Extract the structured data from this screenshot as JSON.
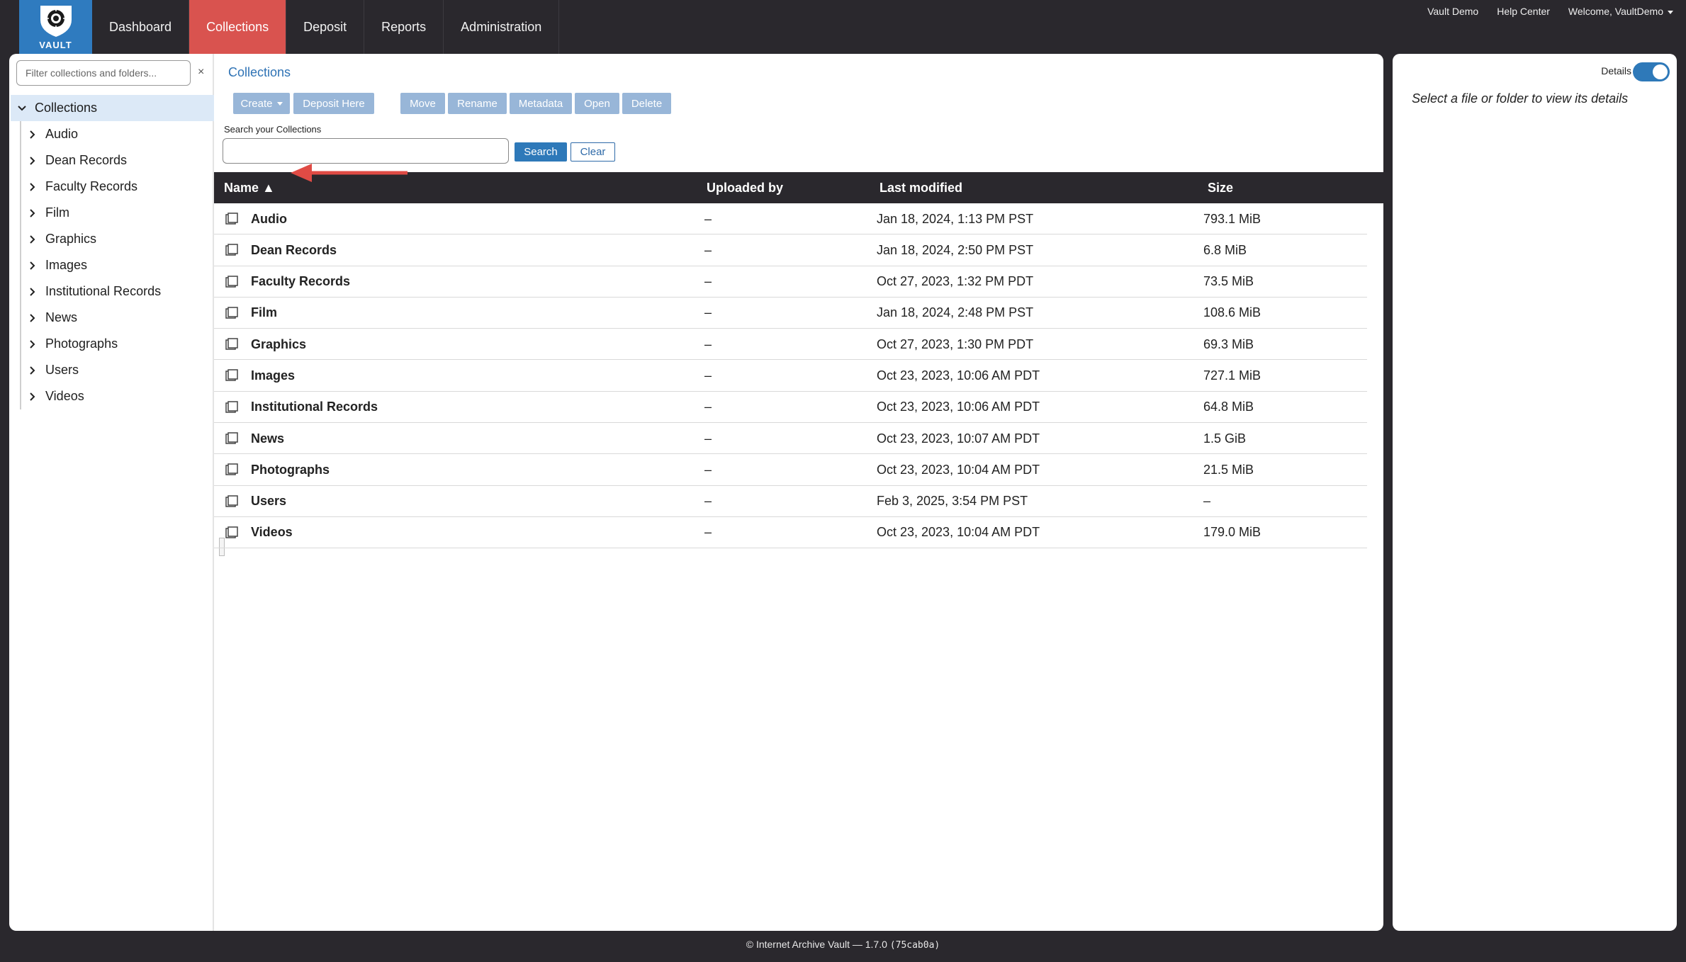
{
  "brand": {
    "logo_text": "VAULT"
  },
  "nav": {
    "items": [
      {
        "label": "Dashboard"
      },
      {
        "label": "Collections",
        "active": true
      },
      {
        "label": "Deposit"
      },
      {
        "label": "Reports"
      },
      {
        "label": "Administration"
      }
    ]
  },
  "toplinks": {
    "org": "Vault Demo",
    "help": "Help Center",
    "welcome": "Welcome, VaultDemo"
  },
  "sidebar": {
    "filter_placeholder": "Filter collections and folders...",
    "clear": "×",
    "root": "Collections",
    "items": [
      "Audio",
      "Dean Records",
      "Faculty Records",
      "Film",
      "Graphics",
      "Images",
      "Institutional Records",
      "News",
      "Photographs",
      "Users",
      "Videos"
    ]
  },
  "content": {
    "breadcrumb": "Collections",
    "toolbar": {
      "create": "Create",
      "deposit_here": "Deposit Here",
      "move": "Move",
      "rename": "Rename",
      "metadata": "Metadata",
      "open": "Open",
      "delete": "Delete"
    },
    "search": {
      "label": "Search your Collections",
      "value": "",
      "search_btn": "Search",
      "clear_btn": "Clear"
    },
    "table": {
      "headers": {
        "name": "Name ▲",
        "uploaded_by": "Uploaded by",
        "last_modified": "Last modified",
        "size": "Size"
      },
      "rows": [
        {
          "name": "Audio",
          "uploaded_by": "–",
          "modified": "Jan 18, 2024, 1:13 PM PST",
          "size": "793.1 MiB"
        },
        {
          "name": "Dean Records",
          "uploaded_by": "–",
          "modified": "Jan 18, 2024, 2:50 PM PST",
          "size": "6.8 MiB"
        },
        {
          "name": "Faculty Records",
          "uploaded_by": "–",
          "modified": "Oct 27, 2023, 1:32 PM PDT",
          "size": "73.5 MiB"
        },
        {
          "name": "Film",
          "uploaded_by": "–",
          "modified": "Jan 18, 2024, 2:48 PM PST",
          "size": "108.6 MiB"
        },
        {
          "name": "Graphics",
          "uploaded_by": "–",
          "modified": "Oct 27, 2023, 1:30 PM PDT",
          "size": "69.3 MiB"
        },
        {
          "name": "Images",
          "uploaded_by": "–",
          "modified": "Oct 23, 2023, 10:06 AM PDT",
          "size": "727.1 MiB"
        },
        {
          "name": "Institutional Records",
          "uploaded_by": "–",
          "modified": "Oct 23, 2023, 10:06 AM PDT",
          "size": "64.8 MiB"
        },
        {
          "name": "News",
          "uploaded_by": "–",
          "modified": "Oct 23, 2023, 10:07 AM PDT",
          "size": "1.5 GiB"
        },
        {
          "name": "Photographs",
          "uploaded_by": "–",
          "modified": "Oct 23, 2023, 10:04 AM PDT",
          "size": "21.5 MiB"
        },
        {
          "name": "Users",
          "uploaded_by": "–",
          "modified": "Feb 3, 2025, 3:54 PM PST",
          "size": "–"
        },
        {
          "name": "Videos",
          "uploaded_by": "–",
          "modified": "Oct 23, 2023, 10:04 AM PDT",
          "size": "179.0 MiB"
        }
      ]
    }
  },
  "details": {
    "label": "Details",
    "toggle_on": true,
    "empty": "Select a file or folder to view its details"
  },
  "footer": {
    "text": "© Internet Archive Vault — 1.7.0",
    "build": "(75cab0a)"
  },
  "colors": {
    "accent": "#2e79b9",
    "active_nav": "#d9534f",
    "header_bg": "#2a282d",
    "annotation_arrow": "#e04b45"
  }
}
